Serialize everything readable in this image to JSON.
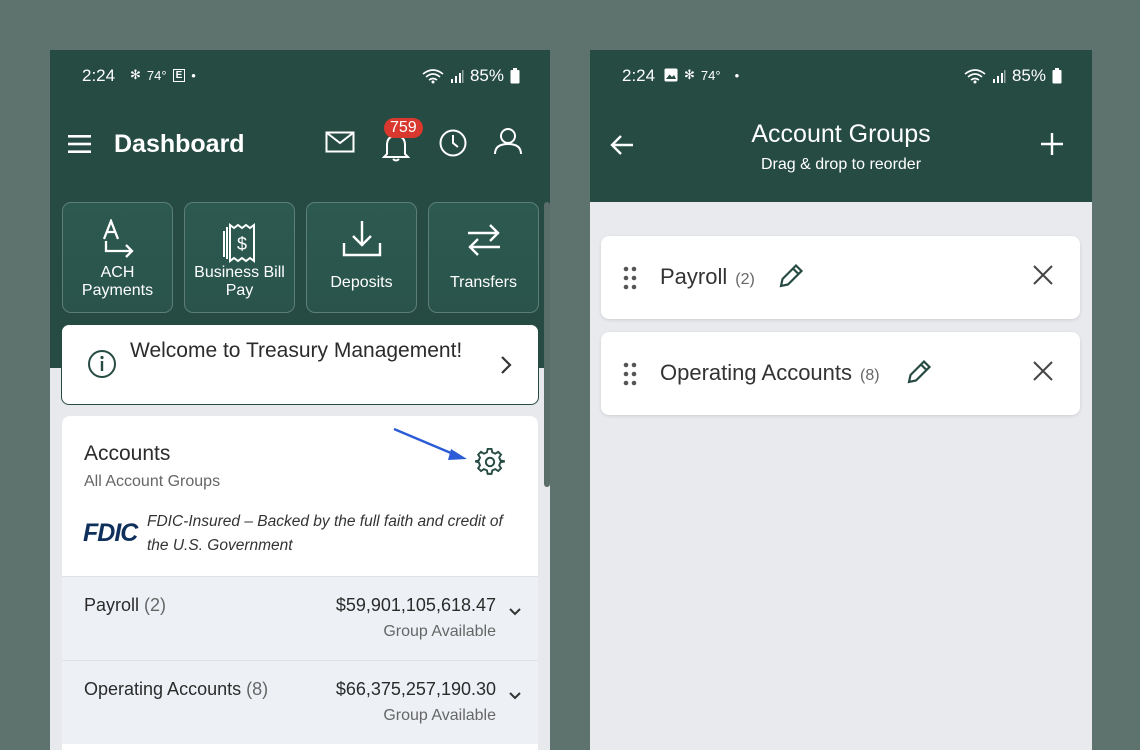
{
  "left_phone": {
    "status": {
      "time": "2:24",
      "temp": "74°",
      "battery": "85%"
    },
    "header": {
      "title": "Dashboard",
      "notifications_count": "759"
    },
    "tiles": [
      {
        "label": "ACH Payments",
        "icon": "ach-icon"
      },
      {
        "label": "Business Bill Pay",
        "icon": "bill-pay-icon"
      },
      {
        "label": "Deposits",
        "icon": "deposit-icon"
      },
      {
        "label": "Transfers",
        "icon": "transfer-icon"
      }
    ],
    "welcome": {
      "text": "Welcome to Treasury Management!"
    },
    "accounts": {
      "title": "Accounts",
      "subtitle": "All Account Groups",
      "fdic_logo": "FDIC",
      "fdic_text": "FDIC-Insured – Backed by the full faith and credit of the U.S. Government",
      "groups": [
        {
          "name": "Payroll",
          "count": "(2)",
          "amount": "$59,901,105,618.47",
          "available_label": "Group Available"
        },
        {
          "name": "Operating Accounts",
          "count": "(8)",
          "amount": "$66,375,257,190.30",
          "available_label": "Group Available"
        }
      ]
    }
  },
  "right_phone": {
    "status": {
      "time": "2:24",
      "temp": "74°",
      "battery": "85%"
    },
    "header": {
      "title": "Account Groups",
      "subtitle": "Drag & drop to reorder"
    },
    "groups": [
      {
        "name": "Payroll",
        "count": "(2)"
      },
      {
        "name": "Operating Accounts",
        "count": "(8)"
      }
    ]
  },
  "colors": {
    "brand_green": "#264b43",
    "badge_red": "#d8382e",
    "annotation_blue": "#2b5bd7",
    "background": "#5f736e"
  }
}
